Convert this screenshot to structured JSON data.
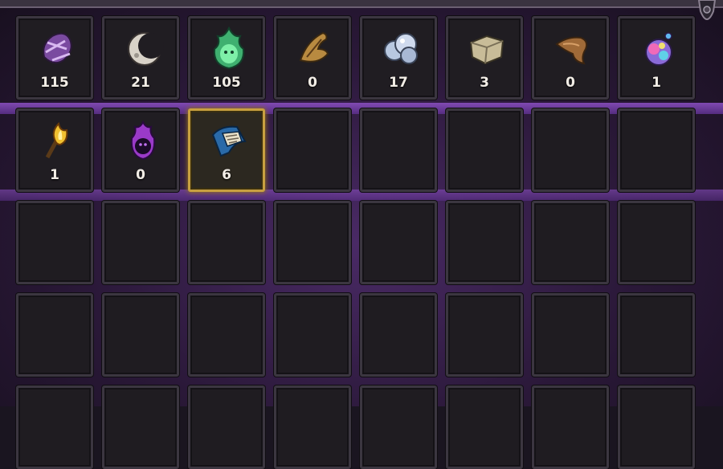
{
  "inventory": {
    "items": [
      {
        "icon": "purple-spiral-shard-icon",
        "count": "115"
      },
      {
        "icon": "pale-moon-crescent-icon",
        "count": "21"
      },
      {
        "icon": "green-glowing-essence-icon",
        "count": "105"
      },
      {
        "icon": "gold-brown-feather-icon",
        "count": "0"
      },
      {
        "icon": "silver-cloud-ore-icon",
        "count": "17"
      },
      {
        "icon": "tan-stone-block-icon",
        "count": "3"
      },
      {
        "icon": "bronze-horn-icon",
        "count": "0"
      },
      {
        "icon": "rainbow-bubble-orb-icon",
        "count": "1"
      },
      {
        "icon": "golden-torch-flame-icon",
        "count": "1"
      },
      {
        "icon": "dark-purple-flame-orb-icon",
        "count": "0"
      },
      {
        "icon": "blue-scroll-icon",
        "count": "6"
      }
    ],
    "selected_index": 10
  }
}
